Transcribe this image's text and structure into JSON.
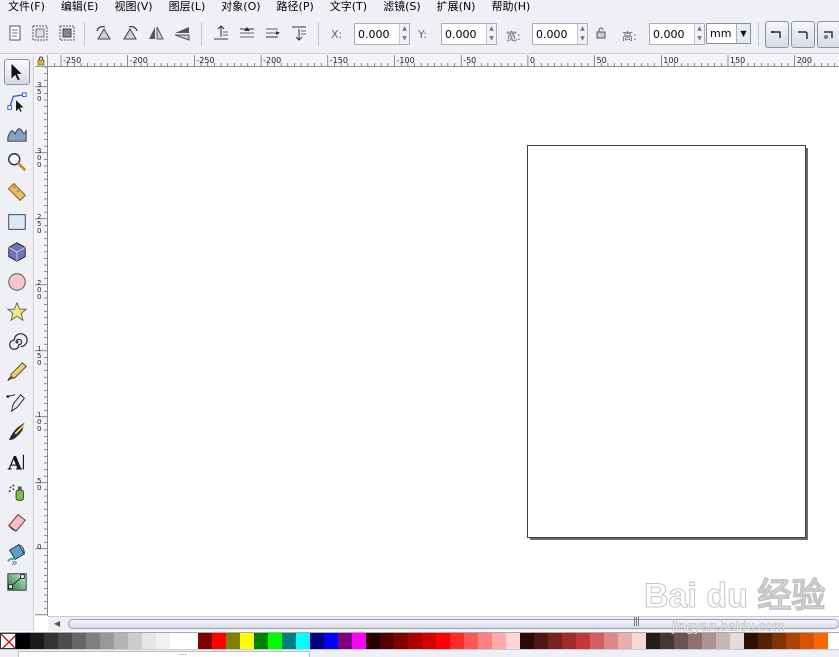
{
  "menu": [
    {
      "label": "文件(F)"
    },
    {
      "label": "编辑(E)"
    },
    {
      "label": "视图(V)"
    },
    {
      "label": "图层(L)"
    },
    {
      "label": "对象(O)"
    },
    {
      "label": "路径(P)"
    },
    {
      "label": "文字(T)"
    },
    {
      "label": "滤镜(S)"
    },
    {
      "label": "扩展(N)"
    },
    {
      "label": "帮助(H)"
    }
  ],
  "toolbar": {
    "x_label": "X:",
    "y_label": "Y:",
    "w_label": "宽:",
    "h_label": "高:",
    "x_value": "0.000",
    "y_value": "0.000",
    "w_value": "0.000",
    "h_value": "0.000",
    "unit": "mm"
  },
  "tools": [
    {
      "name": "selector-tool",
      "icon": "arrow-pointer-icon",
      "active": true
    },
    {
      "name": "node-tool",
      "icon": "node-edit-icon"
    },
    {
      "name": "tweak-tool",
      "icon": "tweak-icon"
    },
    {
      "name": "zoom-tool",
      "icon": "magnifier-icon"
    },
    {
      "name": "measure-tool",
      "icon": "ruler-icon"
    },
    {
      "name": "rectangle-tool",
      "icon": "rectangle-icon"
    },
    {
      "name": "3d-box-tool",
      "icon": "3d-box-icon"
    },
    {
      "name": "ellipse-tool",
      "icon": "ellipse-icon"
    },
    {
      "name": "star-tool",
      "icon": "star-icon"
    },
    {
      "name": "spiral-tool",
      "icon": "spiral-icon"
    },
    {
      "name": "pencil-tool",
      "icon": "pencil-icon"
    },
    {
      "name": "pen-tool",
      "icon": "pen-icon"
    },
    {
      "name": "calligraphy-tool",
      "icon": "calligraphy-icon"
    },
    {
      "name": "text-tool",
      "icon": "text-icon"
    },
    {
      "name": "spray-tool",
      "icon": "spray-icon"
    },
    {
      "name": "eraser-tool",
      "icon": "eraser-icon"
    },
    {
      "name": "paint-bucket-tool",
      "icon": "bucket-icon"
    },
    {
      "name": "gradient-tool",
      "icon": "gradient-icon"
    }
  ],
  "toolbox_more": "»",
  "h_ruler_labels": [
    "-250",
    "-200",
    "-250",
    "-200",
    "-150",
    "-100",
    "-50",
    "0",
    "50",
    "100",
    "150",
    "200"
  ],
  "v_ruler_labels": [
    "3 5 0",
    "3 0 0",
    "2 5 0",
    "2 0 0",
    "1 5 0",
    "1 0 0",
    "5 0",
    "0"
  ],
  "scrollbar_grip": "|||",
  "status_grip": "...",
  "palette": {
    "colors": [
      "#000000",
      "#1a1a1a",
      "#333333",
      "#4d4d4d",
      "#666666",
      "#808080",
      "#999999",
      "#b3b3b3",
      "#cccccc",
      "#e6e6e6",
      "#f2f2f2",
      "#ffffff",
      "#ffffff",
      "#800000",
      "#ff0000",
      "#808000",
      "#ffff00",
      "#008000",
      "#00ff00",
      "#008080",
      "#00ffff",
      "#000080",
      "#0000ff",
      "#800080",
      "#ff00ff",
      "#2b0000",
      "#550000",
      "#800000",
      "#aa0000",
      "#d40000",
      "#ff0000",
      "#ff2a2a",
      "#ff5555",
      "#ff8080",
      "#ffaaaa",
      "#ffd5d5",
      "#280b0b",
      "#501616",
      "#782121",
      "#a02c2c",
      "#c83737",
      "#d35f5f",
      "#de8787",
      "#e9afaf",
      "#f4d7d7",
      "#241c1c",
      "#483737",
      "#6c5353",
      "#916f6f",
      "#ac9393",
      "#c8b7b7",
      "#e3dbdb",
      "#2b1100",
      "#552200",
      "#803300",
      "#aa4400",
      "#d45500",
      "#ff6600"
    ]
  },
  "watermark": {
    "brand": "Bai du 经验",
    "url": "jingyan.baidu.com"
  }
}
